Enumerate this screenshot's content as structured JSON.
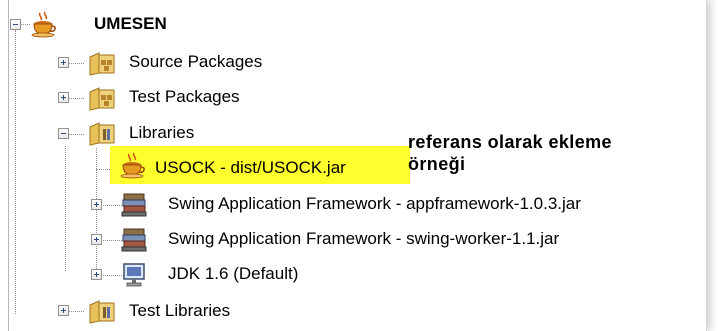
{
  "tree": {
    "root": {
      "label": "UMESEN",
      "icon": "coffee-cup-project-icon",
      "expanded": true
    },
    "items": [
      {
        "label": "Source Packages",
        "icon": "package-folder-icon",
        "expanded": false
      },
      {
        "label": "Test Packages",
        "icon": "package-folder-icon",
        "expanded": false
      },
      {
        "label": "Libraries",
        "icon": "library-folder-icon",
        "expanded": true,
        "children": [
          {
            "label": "USOCK - dist/USOCK.jar",
            "icon": "coffee-cup-project-icon",
            "highlighted": true
          },
          {
            "label": "Swing Application Framework - appframework-1.0.3.jar",
            "icon": "library-books-icon",
            "expanded": false
          },
          {
            "label": "Swing Application Framework - swing-worker-1.1.jar",
            "icon": "library-books-icon",
            "expanded": false
          },
          {
            "label": "JDK 1.6 (Default)",
            "icon": "jdk-monitor-icon",
            "expanded": false
          }
        ]
      },
      {
        "label": "Test Libraries",
        "icon": "library-folder-icon",
        "expanded": false
      }
    ]
  },
  "annotation": {
    "line1": "referans olarak ekleme",
    "line2": "örneği"
  },
  "colors": {
    "highlight": "#ffff2e",
    "toggle_sign": "#2d4a83",
    "tree_lines": "#8f8f8f"
  }
}
